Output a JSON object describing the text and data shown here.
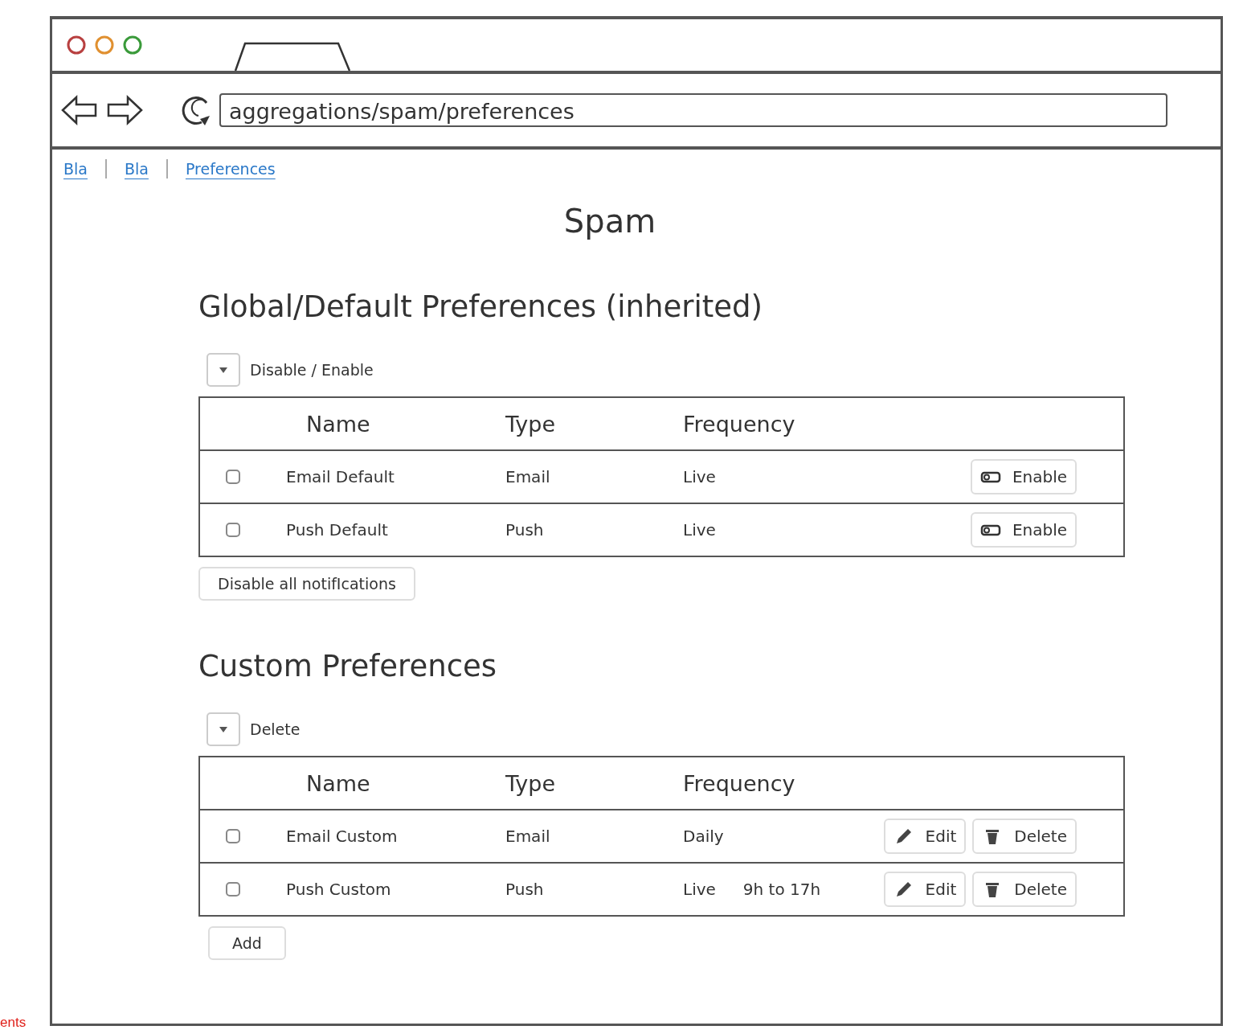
{
  "window": {
    "address": "aggregations/spam/preferences"
  },
  "breadcrumbs": [
    {
      "label": "Bla"
    },
    {
      "label": "Bla"
    },
    {
      "label": "Preferences"
    }
  ],
  "page_title": "Spam",
  "sections": [
    {
      "title": "Global/Default Preferences (inherited)",
      "bulk_action": "Disable / Enable",
      "columns": [
        "Name",
        "Type",
        "Frequency"
      ],
      "rows": [
        {
          "checked": false,
          "name": "Email Default",
          "type": "Email",
          "frequency": "Live",
          "actions": [
            {
              "kind": "enable",
              "label": "Enable"
            }
          ]
        },
        {
          "checked": false,
          "name": "Push Default",
          "type": "Push",
          "frequency": "Live",
          "actions": [
            {
              "kind": "enable",
              "label": "Enable"
            }
          ]
        }
      ],
      "footer_button": "Disable all notifIcations"
    },
    {
      "title": "Custom Preferences",
      "bulk_action": "Delete",
      "columns": [
        "Name",
        "Type",
        "Frequency"
      ],
      "rows": [
        {
          "checked": false,
          "name": "Email Custom",
          "type": "Email",
          "frequency": "Daily",
          "actions": [
            {
              "kind": "edit",
              "label": "Edit"
            },
            {
              "kind": "delete",
              "label": "Delete"
            }
          ]
        },
        {
          "checked": false,
          "name": "Push Custom",
          "type": "Push",
          "frequency": "Live",
          "schedule": "9h to 17h",
          "actions": [
            {
              "kind": "edit",
              "label": "Edit"
            },
            {
              "kind": "delete",
              "label": "Delete"
            }
          ]
        }
      ],
      "footer_button": "Add"
    }
  ],
  "edge_text": "ents"
}
